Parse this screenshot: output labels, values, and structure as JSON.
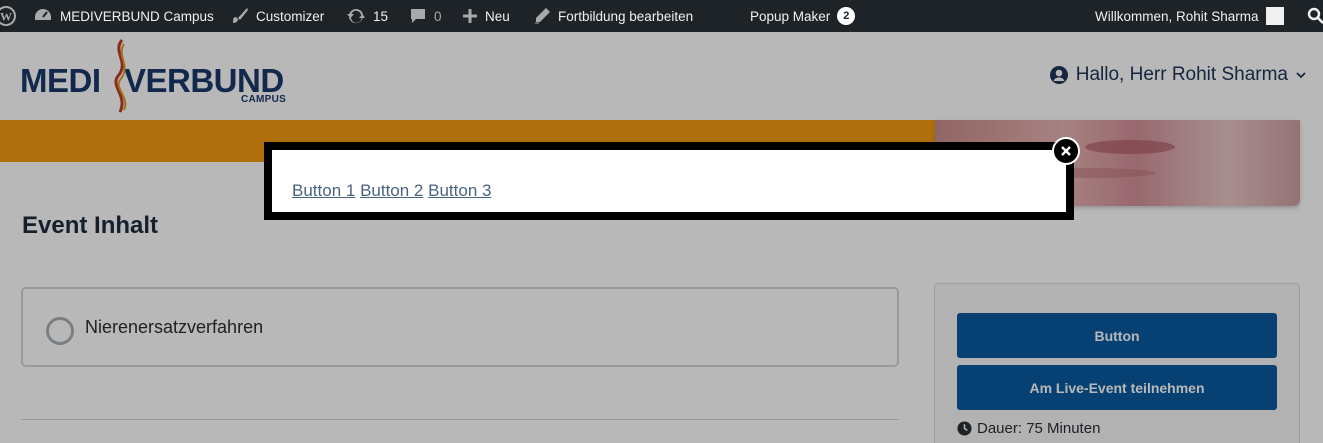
{
  "adminbar": {
    "site_name": "MEDIVERBUND Campus",
    "customizer": "Customizer",
    "updates_count": "15",
    "comments_count": "0",
    "new_label": "Neu",
    "edit_label": "Fortbildung bearbeiten",
    "popup_maker_label": "Popup Maker",
    "popup_maker_badge": "2",
    "welcome": "Willkommen, Rohit Sharma"
  },
  "header": {
    "logo_main_left": "MEDI",
    "logo_main_right": "VERBUND",
    "logo_sub": "CAMPUS",
    "user_greeting": "Hallo, Herr Rohit Sharma"
  },
  "main": {
    "section_title": "Event Inhalt",
    "topic": "Nierenersatzverfahren"
  },
  "sidebar": {
    "button_label": "Button",
    "join_label": "Am Live-Event teilnehmen",
    "duration": "Dauer: 75 Minuten"
  },
  "popup": {
    "links": [
      "Button 1",
      "Button 2",
      "Button 3"
    ]
  },
  "colors": {
    "adminbar": "#1d2327",
    "orange": "#f39a12",
    "primary_button": "#0a5aa0",
    "brand_navy": "#1a3a6b"
  }
}
